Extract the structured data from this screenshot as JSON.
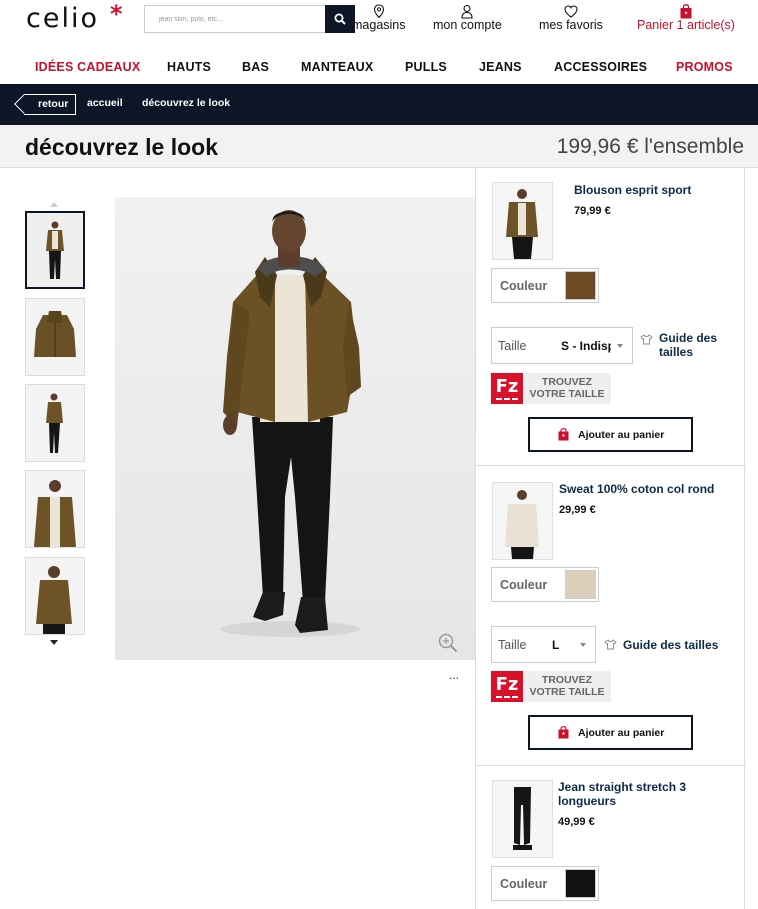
{
  "header": {
    "logo": "celio",
    "logo_star": "*",
    "search_placeholder": "jean slim, polo, etc...",
    "stores_label": "magasins",
    "account_label": "mon compte",
    "favorites_label": "mes favoris",
    "cart_label": "Panier 1 article(s)"
  },
  "nav": {
    "items": [
      {
        "label": "IDÉES CADEAUX",
        "red": true
      },
      {
        "label": "HAUTS"
      },
      {
        "label": "BAS"
      },
      {
        "label": "MANTEAUX"
      },
      {
        "label": "PULLS"
      },
      {
        "label": "JEANS"
      },
      {
        "label": "ACCESSOIRES"
      },
      {
        "label": "PROMOS",
        "red": true
      }
    ]
  },
  "breadcrumb": {
    "back_label": "retour",
    "items": [
      "accueil",
      "découvrez le look"
    ]
  },
  "page": {
    "title": "découvrez le look",
    "total_price": "199,96 €  l'ensemble"
  },
  "gallery": {
    "more_label": "..."
  },
  "products": [
    {
      "name": "Blouson esprit sport",
      "price": "79,99 €",
      "couleur_label": "Couleur",
      "swatch_color": "#6b4a24",
      "taille_label": "Taille",
      "taille_value": "S - Indisponible",
      "guide_label": "Guide des tailles",
      "fz_label": "TROUVEZ VOTRE TAILLE",
      "fz_logo": "Fz",
      "add_label": "Ajouter au panier"
    },
    {
      "name": "Sweat 100% coton col rond",
      "price": "29,99 €",
      "couleur_label": "Couleur",
      "swatch_color": "#dcd0bd",
      "taille_label": "Taille",
      "taille_value": "L",
      "guide_label": "Guide des tailles",
      "fz_label": "TROUVEZ VOTRE TAILLE",
      "fz_logo": "Fz",
      "add_label": "Ajouter au panier"
    },
    {
      "name": "Jean straight stretch 3 longueurs",
      "price": "49,99 €",
      "couleur_label": "Couleur",
      "swatch_color": "#111111"
    }
  ],
  "colors": {
    "brand_red": "#c8102e",
    "navy": "#0c1626",
    "link_navy": "#0c2a4a"
  }
}
